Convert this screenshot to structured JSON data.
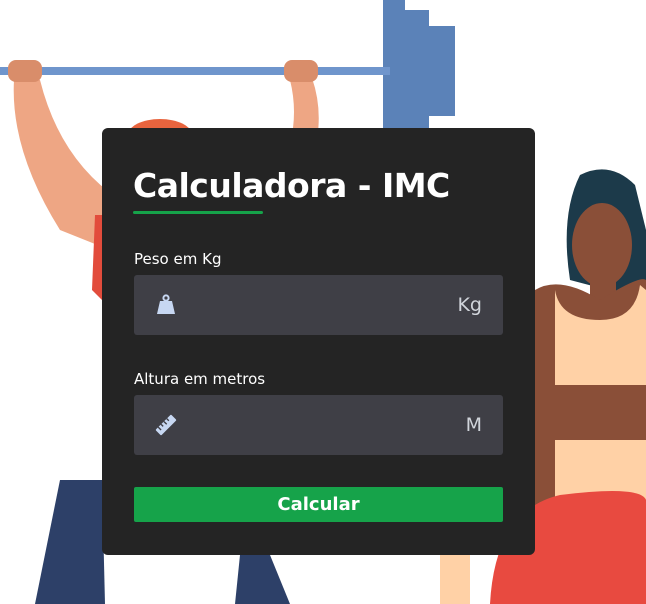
{
  "colors": {
    "card_background": "#242424",
    "input_background": "#3f3f46",
    "accent": "#16a34a",
    "text": "#ffffff"
  },
  "title": "Calculadora - IMC",
  "weight": {
    "label": "Peso em Kg",
    "value": "",
    "unit": "Kg",
    "icon": "weight-icon"
  },
  "height": {
    "label": "Altura em metros",
    "value": "",
    "unit": "M",
    "icon": "ruler-icon"
  },
  "button": {
    "label": "Calcular"
  }
}
